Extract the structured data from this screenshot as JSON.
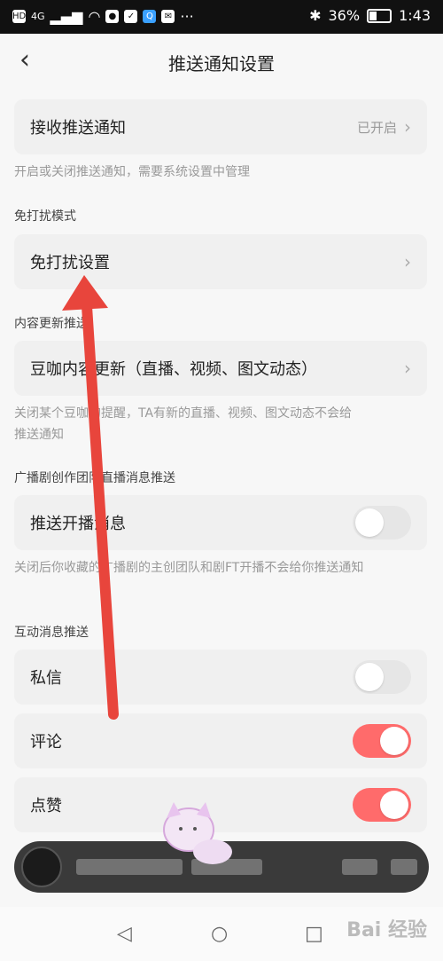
{
  "status": {
    "battery": "36%",
    "time": "1:43",
    "network": "4G"
  },
  "header": {
    "title": "推送通知设置"
  },
  "receive": {
    "label": "接收推送通知",
    "value": "已开启",
    "note": "开启或关闭推送通知，需要系统设置中管理"
  },
  "dnd": {
    "section": "免打扰模式",
    "label": "免打扰设置"
  },
  "content_update": {
    "section": "内容更新推送",
    "label": "豆咖内容更新（直播、视频、图文动态）",
    "note_line1": "关闭某个豆咖的提醒，TA有新的直播、视频、图文动态不会给",
    "note_line2": "推送通知"
  },
  "drama": {
    "section": "广播剧创作团队直播消息推送",
    "label": "推送开播消息",
    "toggle_on": false,
    "note": "关闭后你收藏的广播剧的主创团队和剧FT开播不会给你推送通知"
  },
  "interaction": {
    "section": "互动消息推送",
    "items": [
      {
        "label": "私信",
        "on": false
      },
      {
        "label": "评论",
        "on": true
      },
      {
        "label": "点赞",
        "on": true
      }
    ]
  },
  "watermark": "Bai 经验",
  "colors": {
    "accent": "#ff6b6b",
    "arrow": "#e8453c",
    "background": "#f7f7f7"
  }
}
